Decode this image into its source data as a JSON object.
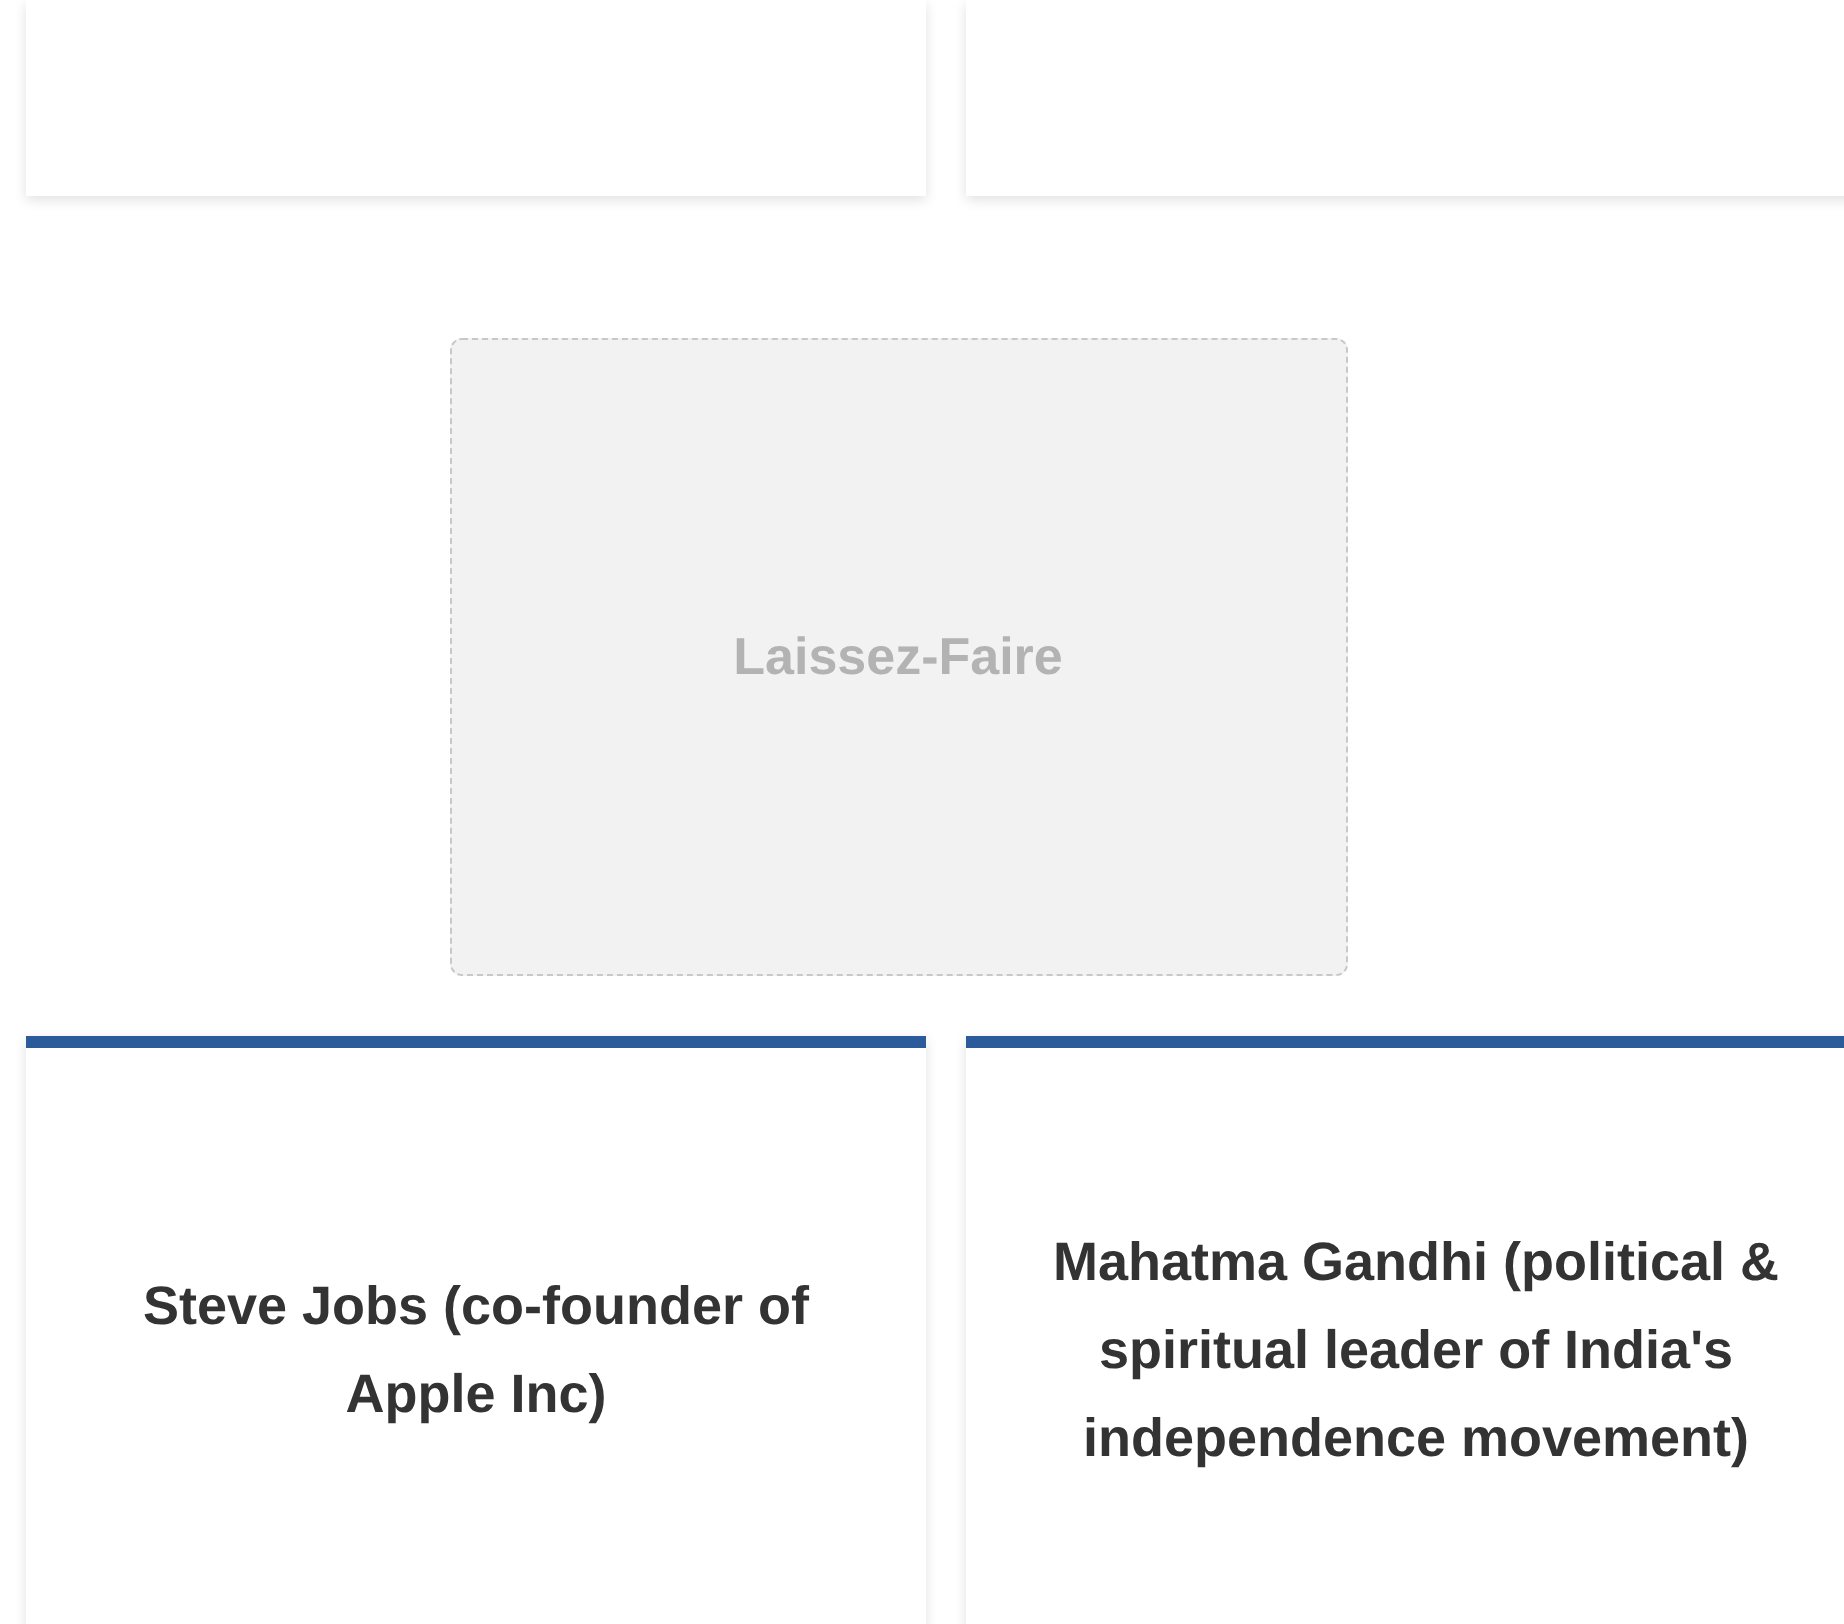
{
  "placeholder_box": {
    "label": "Laissez-Faire"
  },
  "cards": [
    {
      "title": "Steve Jobs (co-founder of Apple Inc)"
    },
    {
      "title": "Mahatma Gandhi (political & spiritual leader of India's independence movement)"
    }
  ]
}
